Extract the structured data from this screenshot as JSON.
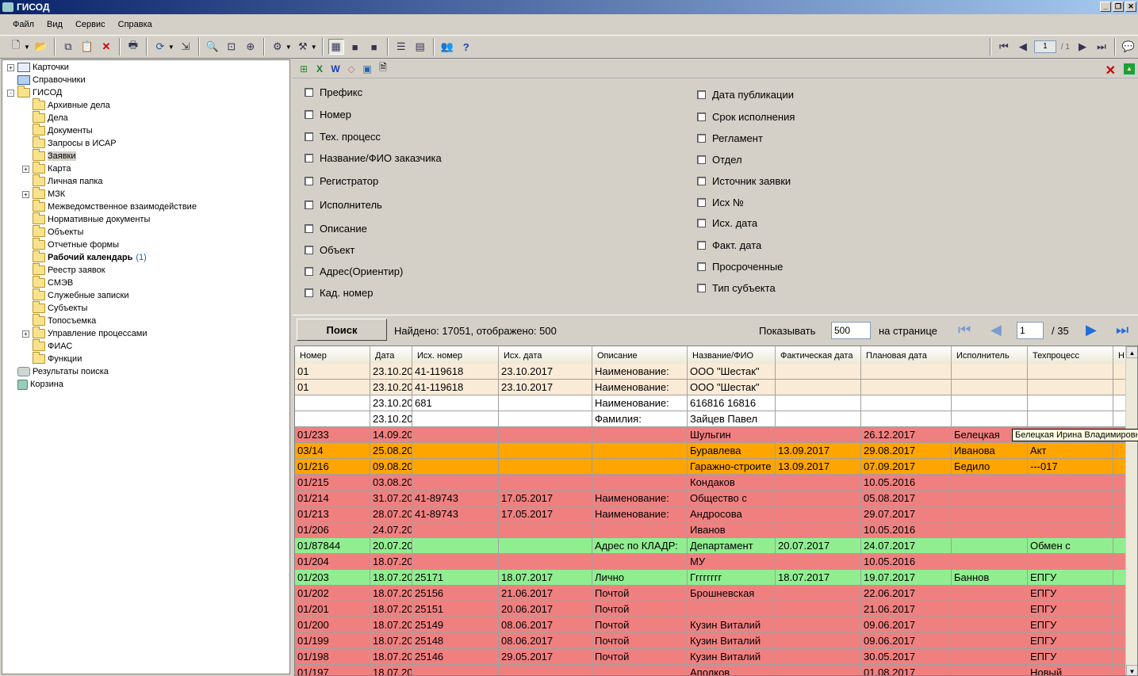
{
  "window": {
    "title": "ГИСОД"
  },
  "menu": [
    "Файл",
    "Вид",
    "Сервис",
    "Справка"
  ],
  "toolbar": {
    "icons": [
      "new-card-icon",
      "open-folder-icon",
      "copy-icon",
      "paste-icon",
      "delete-icon",
      "print-icon",
      "refresh-icon",
      "export-icon",
      "find-icon",
      "zoom-icon",
      "zoom-alt-icon",
      "settings-icon",
      "tools-icon",
      "layout1-icon",
      "layout2-icon",
      "layout3-icon",
      "list-icon",
      "details-icon",
      "users-icon",
      "help-icon"
    ],
    "pager": {
      "page": "1",
      "total": "/ 1"
    }
  },
  "tree": [
    {
      "label": "Карточки",
      "level": 0,
      "icon": "card",
      "expand": "+"
    },
    {
      "label": "Справочники",
      "level": 0,
      "icon": "book",
      "expand": ""
    },
    {
      "label": "ГИСОД",
      "level": 0,
      "icon": "folder",
      "expand": "-"
    },
    {
      "label": "Архивные дела",
      "level": 1,
      "icon": "folder",
      "expand": ""
    },
    {
      "label": "Дела",
      "level": 1,
      "icon": "folder",
      "expand": ""
    },
    {
      "label": "Документы",
      "level": 1,
      "icon": "folder",
      "expand": ""
    },
    {
      "label": "Запросы в ИСАР",
      "level": 1,
      "icon": "folder",
      "expand": ""
    },
    {
      "label": "Заявки",
      "level": 1,
      "icon": "folder",
      "expand": "",
      "selected": true
    },
    {
      "label": "Карта",
      "level": 1,
      "icon": "folder",
      "expand": "+"
    },
    {
      "label": "Личная папка",
      "level": 1,
      "icon": "folder",
      "expand": ""
    },
    {
      "label": "МЗК",
      "level": 1,
      "icon": "folder",
      "expand": "+"
    },
    {
      "label": "Межведомственное взаимодействие",
      "level": 1,
      "icon": "folder",
      "expand": ""
    },
    {
      "label": "Нормативные документы",
      "level": 1,
      "icon": "folder",
      "expand": ""
    },
    {
      "label": "Объекты",
      "level": 1,
      "icon": "folder",
      "expand": ""
    },
    {
      "label": "Отчетные формы",
      "level": 1,
      "icon": "folder",
      "expand": ""
    },
    {
      "label": "Рабочий календарь",
      "level": 1,
      "icon": "folder",
      "expand": "",
      "bold": true,
      "count": "(1)"
    },
    {
      "label": "Реестр заявок",
      "level": 1,
      "icon": "folder",
      "expand": ""
    },
    {
      "label": "СМЭВ",
      "level": 1,
      "icon": "folder",
      "expand": ""
    },
    {
      "label": "Служебные записки",
      "level": 1,
      "icon": "folder",
      "expand": ""
    },
    {
      "label": "Субъекты",
      "level": 1,
      "icon": "folder",
      "expand": ""
    },
    {
      "label": "Топосъемка",
      "level": 1,
      "icon": "folder",
      "expand": ""
    },
    {
      "label": "Управление процессами",
      "level": 1,
      "icon": "folder",
      "expand": "+"
    },
    {
      "label": "ФИАС",
      "level": 1,
      "icon": "folder",
      "expand": ""
    },
    {
      "label": "Функции",
      "level": 1,
      "icon": "folder",
      "expand": ""
    },
    {
      "label": "Результаты поиска",
      "level": 0,
      "icon": "search",
      "expand": ""
    },
    {
      "label": "Корзина",
      "level": 0,
      "icon": "trash",
      "expand": ""
    }
  ],
  "filters": {
    "left": [
      "Префикс",
      "Номер",
      "Тех. процесс",
      "Название/ФИО заказчика",
      "Регистратор",
      "Исполнитель",
      "Описание",
      "Объект",
      "Адрес(Ориентир)",
      "Кад. номер"
    ],
    "right": [
      "Дата публикации",
      "Срок исполнения",
      "Регламент",
      "Отдел",
      "Источник заявки",
      "Исх №",
      "Исх. дата",
      "Факт. дата",
      "Просроченные",
      "Тип субъекта"
    ]
  },
  "search": {
    "button": "Поиск",
    "found": "Найдено: 17051, отображено: 500",
    "show_label": "Показывать",
    "show_value": "500",
    "per_page_label": "на странице",
    "page": "1",
    "total_pages": "/ 35"
  },
  "grid": {
    "columns": [
      "Номер",
      "Дата",
      "Исх. номер",
      "Исх. дата",
      "Описание",
      "Название/ФИО",
      "Фактическая дата",
      "Плановая дата",
      "Исполнитель",
      "Техпроцесс",
      "Н"
    ],
    "colors": {
      "beige": "#faebd7",
      "white": "#ffffff",
      "red": "#f08080",
      "orange": "#ffa500",
      "green": "#90ee90"
    },
    "rows": [
      {
        "color": "beige",
        "cells": [
          "01",
          "23.10.20",
          "41-119618",
          "23.10.2017",
          "Наименование:",
          "ООО \"Шестак\"",
          "",
          "",
          "",
          "",
          ""
        ]
      },
      {
        "color": "beige",
        "cells": [
          "01",
          "23.10.20",
          "41-119618",
          "23.10.2017",
          "Наименование:",
          "ООО \"Шестак\"",
          "",
          "",
          "",
          "",
          ""
        ]
      },
      {
        "color": "white",
        "cells": [
          "",
          "23.10.20",
          "681",
          "",
          "Наименование:",
          "616816 16816",
          "",
          "",
          "",
          "",
          ""
        ]
      },
      {
        "color": "white",
        "cells": [
          "",
          "23.10.20",
          "",
          "",
          "Фамилия:",
          "Зайцев Павел",
          "",
          "",
          "",
          "",
          ""
        ]
      },
      {
        "color": "red",
        "cells": [
          "01/233",
          "14.09.20",
          "",
          "",
          "",
          "Шульгин",
          "",
          "26.12.2017",
          "Белецкая",
          "",
          ""
        ]
      },
      {
        "color": "orange",
        "cells": [
          "03/14",
          "25.08.20",
          "",
          "",
          "",
          "Буравлева",
          "13.09.2017",
          "29.08.2017",
          "Иванова",
          "Акт",
          ""
        ]
      },
      {
        "color": "orange",
        "cells": [
          "01/216",
          "09.08.20",
          "",
          "",
          "",
          "Гаражно-строите",
          "13.09.2017",
          "07.09.2017",
          "Бедило",
          "---017",
          ""
        ]
      },
      {
        "color": "red",
        "cells": [
          "01/215",
          "03.08.20",
          "",
          "",
          "",
          "Кондаков",
          "",
          "10.05.2016",
          "",
          "",
          ""
        ]
      },
      {
        "color": "red",
        "cells": [
          "01/214",
          "31.07.20",
          "41-89743",
          "17.05.2017",
          "Наименование:",
          "Общество с",
          "",
          "05.08.2017",
          "",
          "",
          ""
        ]
      },
      {
        "color": "red",
        "cells": [
          "01/213",
          "28.07.20",
          "41-89743",
          "17.05.2017",
          "Наименование:",
          "Андросова",
          "",
          "29.07.2017",
          "",
          "",
          ""
        ]
      },
      {
        "color": "red",
        "cells": [
          "01/206",
          "24.07.20",
          "",
          "",
          "",
          "Иванов",
          "",
          "10.05.2016",
          "",
          "",
          ""
        ]
      },
      {
        "color": "green",
        "cells": [
          "01/87844",
          "20.07.20",
          "",
          "",
          "Адрес по КЛАДР:",
          "Департамент",
          "20.07.2017",
          "24.07.2017",
          "",
          "Обмен с",
          ""
        ]
      },
      {
        "color": "red",
        "cells": [
          "01/204",
          "18.07.20",
          "",
          "",
          "",
          "МУ",
          "",
          "10.05.2016",
          "",
          "",
          ""
        ]
      },
      {
        "color": "green",
        "cells": [
          "01/203",
          "18.07.20",
          "25171",
          "18.07.2017",
          "Лично",
          "Гггггггг",
          "18.07.2017",
          "19.07.2017",
          "Баннов",
          "ЕПГУ",
          ""
        ]
      },
      {
        "color": "red",
        "cells": [
          "01/202",
          "18.07.20",
          "25156",
          "21.06.2017",
          "Почтой",
          "Брошневская",
          "",
          "22.06.2017",
          "",
          "ЕПГУ",
          ""
        ]
      },
      {
        "color": "red",
        "cells": [
          "01/201",
          "18.07.20",
          "25151",
          "20.06.2017",
          "Почтой",
          "",
          "",
          "21.06.2017",
          "",
          "ЕПГУ",
          ""
        ]
      },
      {
        "color": "red",
        "cells": [
          "01/200",
          "18.07.20",
          "25149",
          "08.06.2017",
          "Почтой",
          "Кузин Виталий",
          "",
          "09.06.2017",
          "",
          "ЕПГУ",
          ""
        ]
      },
      {
        "color": "red",
        "cells": [
          "01/199",
          "18.07.20",
          "25148",
          "08.06.2017",
          "Почтой",
          "Кузин Виталий",
          "",
          "09.06.2017",
          "",
          "ЕПГУ",
          ""
        ]
      },
      {
        "color": "red",
        "cells": [
          "01/198",
          "18.07.20",
          "25146",
          "29.05.2017",
          "Почтой",
          "Кузин Виталий",
          "",
          "30.05.2017",
          "",
          "ЕПГУ",
          ""
        ]
      },
      {
        "color": "red",
        "cells": [
          "01/197",
          "18.07.20",
          "",
          "",
          "",
          "Аполков",
          "",
          "01.08.2017",
          "",
          "Новый",
          ""
        ]
      }
    ]
  },
  "tooltip": "Белецкая Ирина Владимировна"
}
